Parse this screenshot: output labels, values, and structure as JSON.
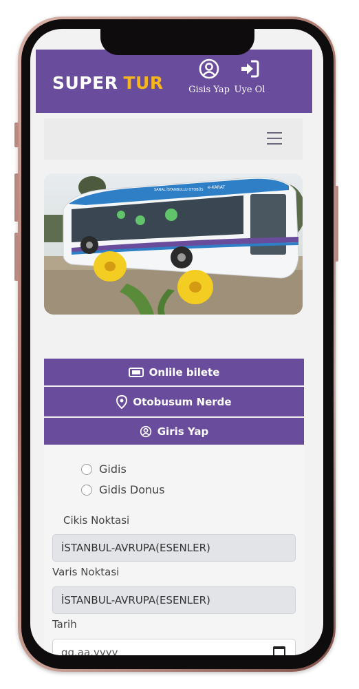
{
  "header": {
    "logo_part1": "SUPER",
    "logo_part2": "TUR",
    "login_label": "Gisis Yap",
    "register_label": "Uye Ol"
  },
  "hero_image": {
    "bus_text_1": "SANAL İSTANBULLU OTOBÜS",
    "bus_text_2": "e-KARAT"
  },
  "buttons": {
    "online_ticket": "Onlile bilete",
    "where_bus": "Otobusum Nerde",
    "login": "Giris Yap"
  },
  "form": {
    "radio_oneway": "Gidis",
    "radio_roundtrip": "Gidis Donus",
    "departure_label": "Cikis Noktasi",
    "departure_value": "İSTANBUL-AVRUPA(ESENLER)",
    "arrival_label": "Varis Noktasi",
    "arrival_value": "İSTANBUL-AVRUPA(ESENLER)",
    "date_label": "Tarih",
    "date_placeholder": "gg.aa.yyyy"
  },
  "colors": {
    "primary": "#6a4c9c",
    "logo_accent": "#f6b51a"
  },
  "icons": [
    "user-circle-icon",
    "sign-in-icon",
    "hamburger-menu-icon",
    "ticket-icon",
    "location-pin-icon",
    "calendar-icon"
  ]
}
